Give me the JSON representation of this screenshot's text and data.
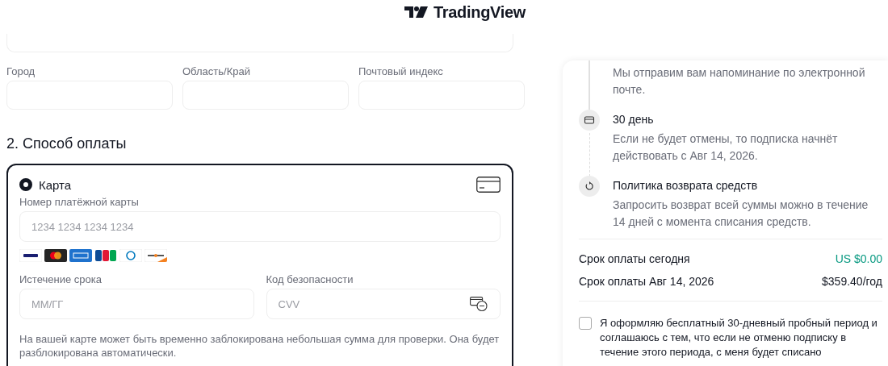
{
  "logo": {
    "text": "TradingView"
  },
  "address": {
    "fields": [
      {
        "label": "Город"
      },
      {
        "label": "Область/Край"
      },
      {
        "label": "Почтовый индекс"
      }
    ]
  },
  "payment": {
    "heading": "2. Способ оплаты",
    "methods": [
      {
        "label": "Карта",
        "selected": true,
        "card_number": {
          "label": "Номер платёжной карты",
          "placeholder": "1234 1234 1234 1234"
        },
        "expiry": {
          "label": "Истечение срока",
          "placeholder": "ММ/ГГ"
        },
        "cvc": {
          "label": "Код безопасности",
          "placeholder": "CVV"
        },
        "note": "На вашей карте может быть временно заблокирована небольшая сумма для проверки. Она будет разблокирована автоматически."
      }
    ]
  },
  "summary": {
    "timeline": [
      {
        "kind": "hidden",
        "text": "Мы отправим вам напоминание по электронной почте."
      },
      {
        "kind": "card",
        "title": "30 день",
        "text": "Если не будет отмены, то подписка начнёт действовать с Авг 14, 2026."
      },
      {
        "kind": "refund",
        "title": "Политика возврата средств",
        "text": "Запросить возврат всей суммы можно в течение 14 дней с момента списания средств."
      }
    ],
    "rows": [
      {
        "label": "Срок оплаты сегодня",
        "value": "US $0.00",
        "highlight": true
      },
      {
        "label": "Срок оплаты Авг 14, 2026",
        "value": "$359.40/год",
        "highlight": false
      }
    ],
    "consent": {
      "checked": false,
      "text": "Я оформляю бесплатный 30-дневный пробный период и соглашаюсь с тем, что если не отменю подписку в течение этого периода, с меня будет списано"
    }
  }
}
